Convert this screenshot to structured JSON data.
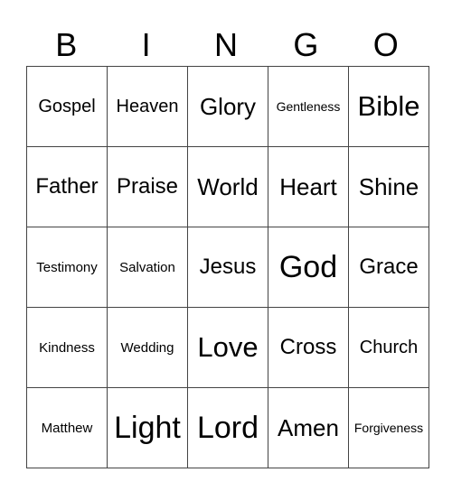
{
  "header": [
    "B",
    "I",
    "N",
    "G",
    "O"
  ],
  "rows": [
    [
      "Gospel",
      "Heaven",
      "Glory",
      "Gentleness",
      "Bible"
    ],
    [
      "Father",
      "Praise",
      "World",
      "Heart",
      "Shine"
    ],
    [
      "Testimony",
      "Salvation",
      "Jesus",
      "God",
      "Grace"
    ],
    [
      "Kindness",
      "Wedding",
      "Love",
      "Cross",
      "Church"
    ],
    [
      "Matthew",
      "Light",
      "Lord",
      "Amen",
      "Forgiveness"
    ]
  ]
}
